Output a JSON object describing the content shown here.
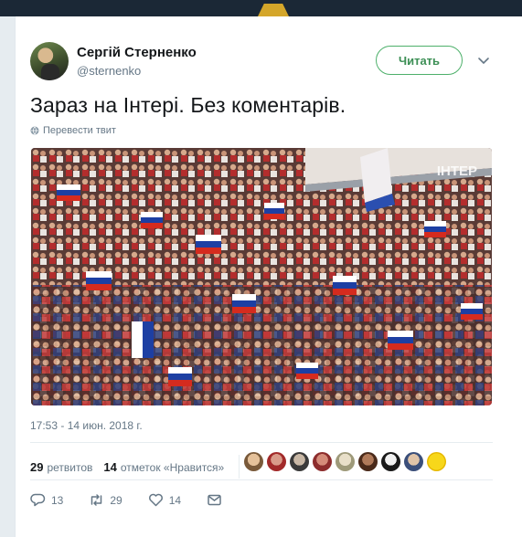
{
  "tweet": {
    "author_name": "Сергій Стерненко",
    "author_handle": "@sternenko",
    "follow_label": "Читать",
    "text": "Зараз на Інтері. Без коментарів.",
    "translate_label": "Перевести твит",
    "media_watermark": "ІНТЕР",
    "timestamp": "17:53 - 14 июн. 2018 г.",
    "retweets_count": "29",
    "retweets_label": "ретвитов",
    "likes_count": "14",
    "likes_label": "отметок «Нравится»",
    "reply_count": "13",
    "retweet_action_count": "29",
    "like_action_count": "14"
  },
  "colors": {
    "follow_accent": "#4db06a",
    "muted_text": "#657786",
    "page_bg": "#e6ecf0"
  },
  "icons": [
    "chevron-down-icon",
    "globe-icon",
    "reply-icon",
    "retweet-icon",
    "heart-icon",
    "mail-icon"
  ]
}
